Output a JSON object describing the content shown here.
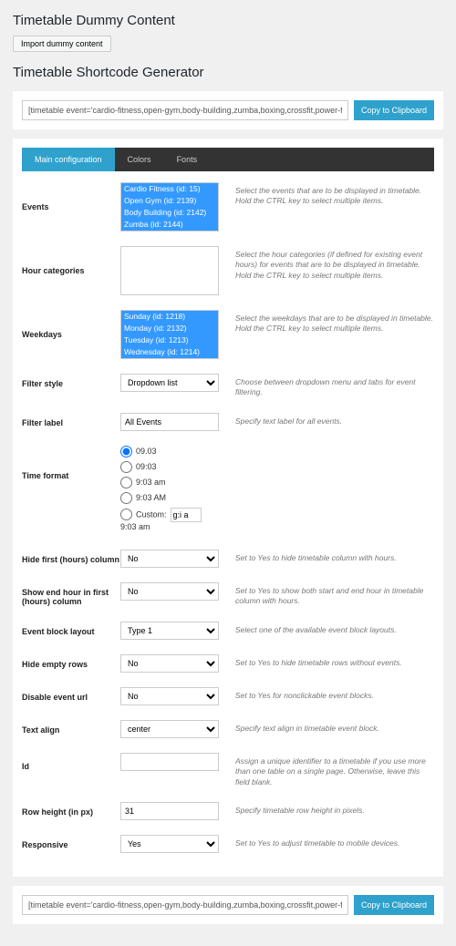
{
  "heading_dummy": "Timetable Dummy Content",
  "import_btn": "Import dummy content",
  "heading_generator": "Timetable Shortcode Generator",
  "shortcode_value": "[timetable event='cardio-fitness,open-gym,body-building,zumba,boxing,crossfit,power-fitnes:",
  "copy_btn": "Copy to Clipboard",
  "tabs": {
    "main": "Main configuration",
    "colors": "Colors",
    "fonts": "Fonts"
  },
  "rows": {
    "events": {
      "label": "Events",
      "help": "Select the events that are to be displayed in timetable. Hold the CTRL key to select multiple items.",
      "opts": [
        "Cardio Fitness (id: 15)",
        "Open Gym (id: 2139)",
        "Body Building (id: 2142)",
        "Zumba (id: 2144)"
      ]
    },
    "hourcat": {
      "label": "Hour categories",
      "help": "Select the hour categories (if defined for existing event hours) for events that are to be displayed in timetable. Hold the CTRL key to select multiple items."
    },
    "weekdays": {
      "label": "Weekdays",
      "help": "Select the weekdays that are to be displayed in timetable. Hold the CTRL key to select multiple items.",
      "opts": [
        "Sunday (id: 1218)",
        "Monday (id: 2132)",
        "Tuesday (id: 1213)",
        "Wednesday (id: 1214)"
      ]
    },
    "filter_style": {
      "label": "Filter style",
      "value": "Dropdown list",
      "help": "Choose between dropdown menu and tabs for event filtering."
    },
    "filter_label": {
      "label": "Filter label",
      "value": "All Events",
      "help": "Specify text label for all events."
    },
    "time_format": {
      "label": "Time format",
      "opts": [
        "09.03",
        "09:03",
        "9:03 am",
        "9:03 AM"
      ],
      "custom": "Custom:",
      "custom_val": "g:i a",
      "custom_preview": "9:03 am"
    },
    "hide_first": {
      "label": "Hide first (hours) column",
      "value": "No",
      "help": "Set to Yes to hide timetable column with hours."
    },
    "show_end": {
      "label": "Show end hour in first (hours) column",
      "value": "No",
      "help": "Set to Yes to show both start and end hour in timetable column with hours."
    },
    "block_layout": {
      "label": "Event block layout",
      "value": "Type 1",
      "help": "Select one of the available event block layouts."
    },
    "hide_empty": {
      "label": "Hide empty rows",
      "value": "No",
      "help": "Set to Yes to hide timetable rows without events."
    },
    "disable_url": {
      "label": "Disable event url",
      "value": "No",
      "help": "Set to Yes for nonclickable event blocks."
    },
    "text_align": {
      "label": "Text align",
      "value": "center",
      "help": "Specify text align in timetable event block."
    },
    "id": {
      "label": "Id",
      "value": "",
      "help": "Assign a unique identifier to a timetable if you use more than one table on a single page. Otherwise, leave this field blank."
    },
    "row_height": {
      "label": "Row height (in px)",
      "value": "31",
      "help": "Specify timetable row height in pixels."
    },
    "responsive": {
      "label": "Responsive",
      "value": "Yes",
      "help": "Set to Yes to adjust timetable to mobile devices."
    }
  }
}
